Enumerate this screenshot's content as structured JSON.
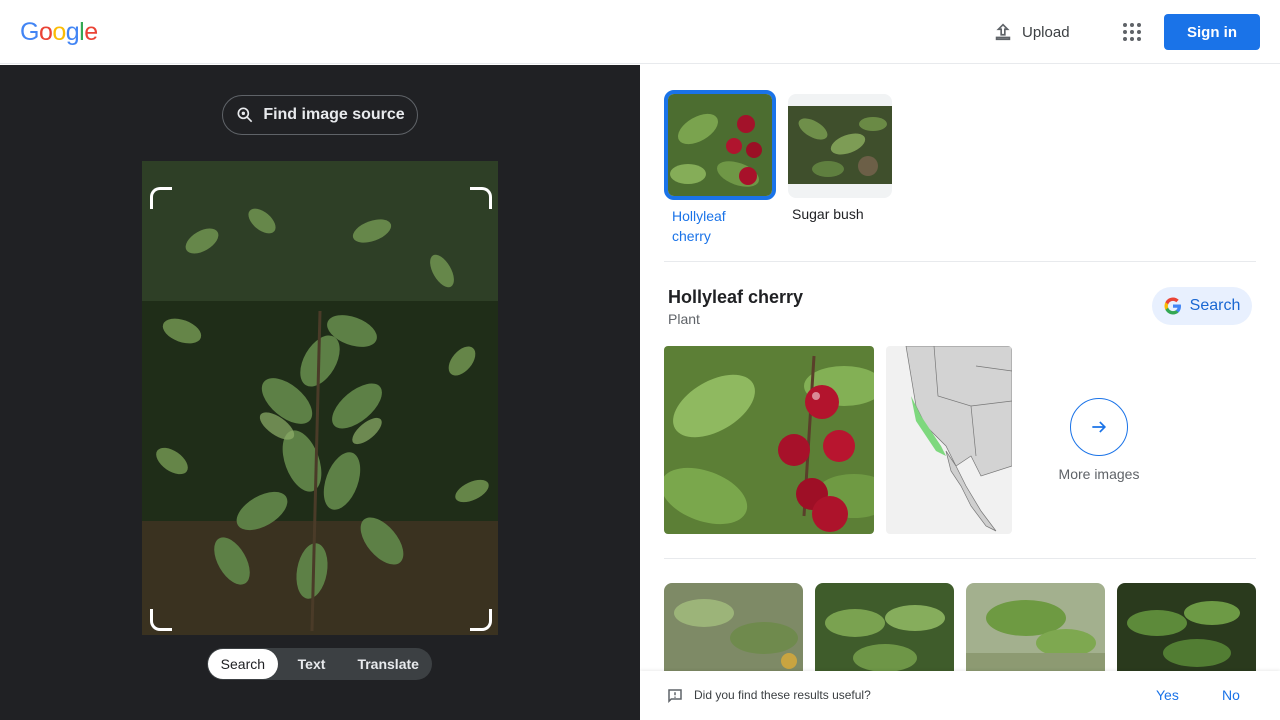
{
  "header": {
    "logo": [
      "G",
      "o",
      "o",
      "g",
      "l",
      "e"
    ],
    "logo_colors": [
      "#4285F4",
      "#EA4335",
      "#FBBC05",
      "#4285F4",
      "#34A853",
      "#EA4335"
    ],
    "upload_label": "Upload",
    "signin_label": "Sign in"
  },
  "left": {
    "find_source_label": "Find image source",
    "tabs": [
      "Search",
      "Text",
      "Translate"
    ],
    "active_tab": "Search"
  },
  "right": {
    "chips": [
      {
        "label": "Hollyleaf cherry",
        "selected": true
      },
      {
        "label": "Sugar bush",
        "selected": false
      }
    ],
    "knowledge": {
      "title": "Hollyleaf cherry",
      "subtitle": "Plant",
      "search_label": "Search",
      "more_images_label": "More images"
    },
    "feedback": {
      "question": "Did you find these results useful?",
      "yes": "Yes",
      "no": "No"
    }
  },
  "colors": {
    "accent": "#1a73e8",
    "dark_pane": "#202124"
  }
}
